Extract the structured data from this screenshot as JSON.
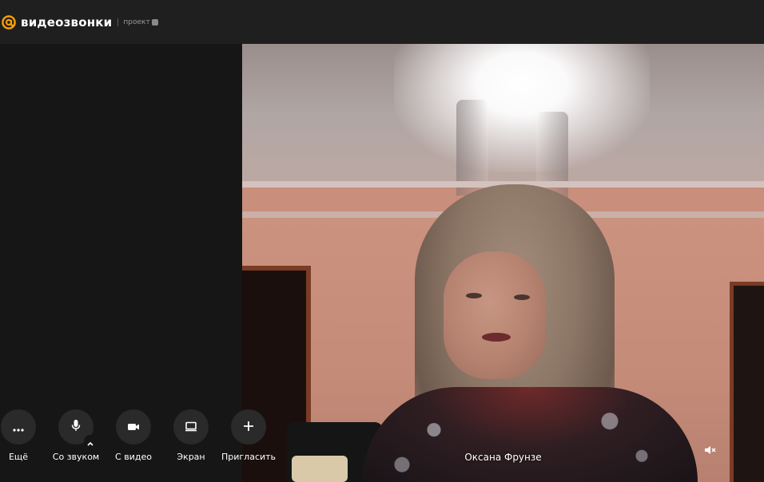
{
  "app": {
    "brand": "видеозвонки",
    "sub": "проект",
    "accent": "#ff9e00"
  },
  "controls": [
    {
      "id": "more",
      "label": "Ещё",
      "icon": "more-icon"
    },
    {
      "id": "audio",
      "label": "Со звуком",
      "icon": "microphone-icon"
    },
    {
      "id": "video",
      "label": "С видео",
      "icon": "camera-icon"
    },
    {
      "id": "screen",
      "label": "Экран",
      "icon": "screen-share-icon"
    },
    {
      "id": "invite",
      "label": "Пригласить",
      "icon": "plus-icon"
    }
  ],
  "participant": {
    "name": "Оксана Фрунзе"
  }
}
